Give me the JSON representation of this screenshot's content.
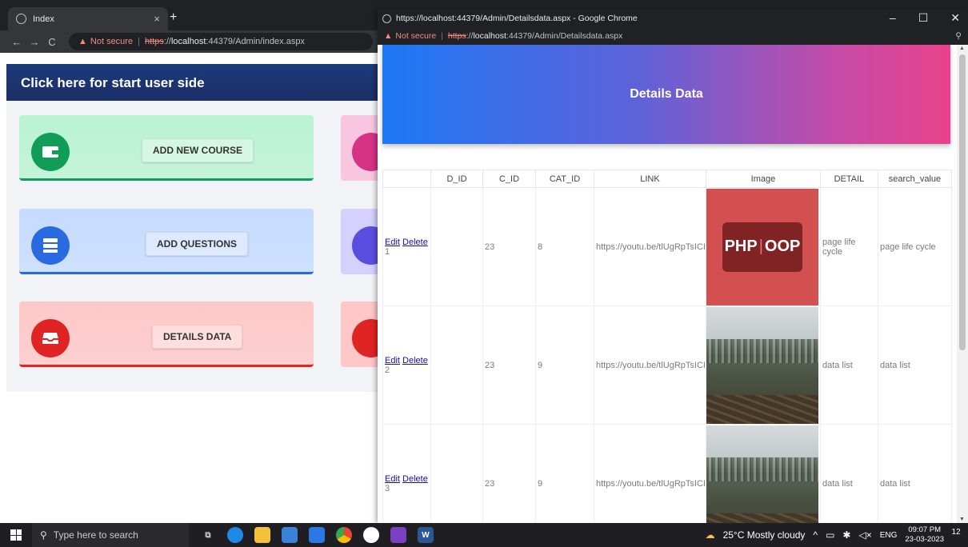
{
  "back_browser": {
    "tab_title": "Index",
    "tab_close": "×",
    "new_tab": "+",
    "security_label": "Not secure",
    "url_scheme": "https",
    "url_host": "localhost",
    "url_rest": ":44379/Admin/index.aspx",
    "banner": "Click here for start user side",
    "cards": [
      {
        "label": "ADD NEW COURSE",
        "color": "#b9f3d3",
        "icon_color": "#0f9d58",
        "icon": "wallet-icon"
      },
      {
        "label": "ADD QUESTIONS",
        "color": "#c5dbff",
        "icon_color": "#2a6ae0",
        "icon": "server-icon"
      },
      {
        "label": "DETAILS DATA",
        "color": "#ffc7c7",
        "icon_color": "#e02424",
        "icon": "inbox-icon"
      }
    ]
  },
  "popup": {
    "window_title": "https://localhost:44379/Admin/Detailsdata.aspx - Google Chrome",
    "security_label": "Not secure",
    "url_scheme": "https",
    "url_host": "localhost",
    "url_rest": ":44379/Admin/Detailsdata.aspx",
    "page_title": "Details Data",
    "columns": [
      "",
      "D_ID",
      "C_ID",
      "CAT_ID",
      "LINK",
      "Image",
      "DETAIL",
      "search_value"
    ],
    "edit_label": "Edit",
    "delete_label": "Delete",
    "rows": [
      {
        "d_id": "1",
        "c_id": "23",
        "cat_id": "8",
        "link": "https://youtu.be/tlUgRpTsICI",
        "image_type": "php",
        "detail": "page life cycle",
        "search_value": "page life cycle"
      },
      {
        "d_id": "2",
        "c_id": "23",
        "cat_id": "9",
        "link": "https://youtu.be/tlUgRpTsICI",
        "image_type": "forest",
        "detail": "data list",
        "search_value": "data list"
      },
      {
        "d_id": "3",
        "c_id": "23",
        "cat_id": "9",
        "link": "https://youtu.be/tlUgRpTsICI",
        "image_type": "forest",
        "detail": "data list",
        "search_value": "data list"
      }
    ],
    "php_badge_left": "PHP",
    "php_badge_right": "OOP"
  },
  "taskbar": {
    "search_placeholder": "Type here to search",
    "weather": "25°C  Mostly cloudy",
    "language": "ENG",
    "time": "09:07 PM",
    "date": "23-03-2023",
    "notifications": "12"
  }
}
